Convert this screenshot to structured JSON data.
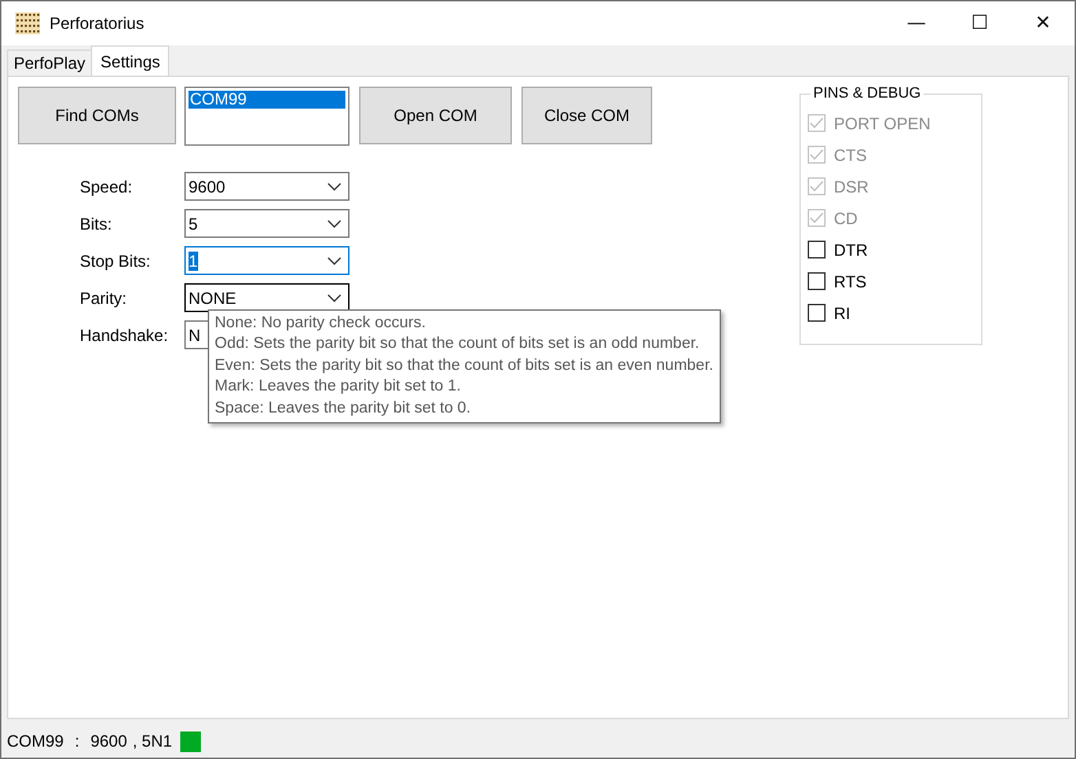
{
  "window": {
    "title": "Perforatorius",
    "controls": [
      "—",
      "☐",
      "✕"
    ]
  },
  "tabs": [
    {
      "label": "PerfoPlay",
      "selected": false
    },
    {
      "label": "Settings",
      "selected": true
    }
  ],
  "buttons": {
    "find": "Find COMs",
    "open": "Open COM",
    "close": "Close COM"
  },
  "port_list": {
    "items": [
      {
        "label": "COM99",
        "selected": true
      }
    ]
  },
  "settings": [
    {
      "label": "Speed:",
      "value": "9600",
      "focused": false,
      "hovered": false
    },
    {
      "label": "Bits:",
      "value": "5",
      "focused": false,
      "hovered": false
    },
    {
      "label": "Stop Bits:",
      "value": "1",
      "focused": true,
      "hovered": false
    },
    {
      "label": "Parity:",
      "value": "NONE",
      "focused": false,
      "hovered": true
    },
    {
      "label": "Handshake:",
      "value": "N",
      "focused": false,
      "hovered": false
    }
  ],
  "tooltip": {
    "lines": [
      "None: No parity check occurs.",
      "Odd: Sets the parity bit so that the count of bits set is an odd number.",
      "Even: Sets the parity bit so that the count of bits set is an even number.",
      "Mark: Leaves the parity bit set to 1.",
      "Space: Leaves the parity bit set to 0."
    ]
  },
  "pins": {
    "title": "PINS & DEBUG",
    "items": [
      {
        "label": "PORT OPEN",
        "checked": true,
        "disabled": true
      },
      {
        "label": "CTS",
        "checked": true,
        "disabled": true
      },
      {
        "label": "DSR",
        "checked": true,
        "disabled": true
      },
      {
        "label": "CD",
        "checked": true,
        "disabled": true
      },
      {
        "label": "DTR",
        "checked": false,
        "disabled": false
      },
      {
        "label": "RTS",
        "checked": false,
        "disabled": false
      },
      {
        "label": "RI",
        "checked": false,
        "disabled": false
      }
    ]
  },
  "status_bar": {
    "port": "COM99",
    "separator": ":",
    "speed": "9600",
    "format": ", 5N1",
    "connected": true
  }
}
